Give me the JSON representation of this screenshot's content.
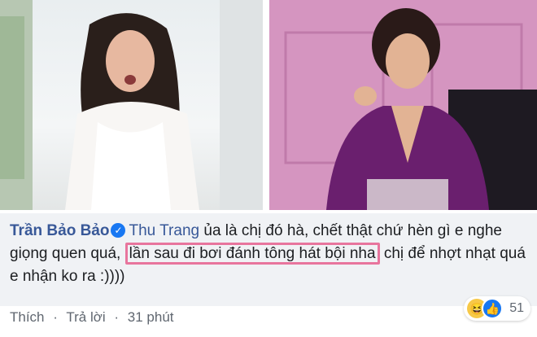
{
  "comment": {
    "author": "Trần Bảo Bảo",
    "mention": "Thu Trang",
    "text_before": " ủa là chị đó hà, chết thật chứ hèn gì e nghe giọng quen quá, ",
    "highlighted": "lần sau đi bơi đánh tông hát bội nha",
    "text_after": " chị để nhợt nhạt quá e nhận ko ra :))))"
  },
  "actions": {
    "like": "Thích",
    "reply": "Trả lời",
    "time": "31 phút",
    "separator": "·"
  },
  "reactions": {
    "count": "51",
    "icons": [
      "haha-icon",
      "like-icon"
    ]
  }
}
